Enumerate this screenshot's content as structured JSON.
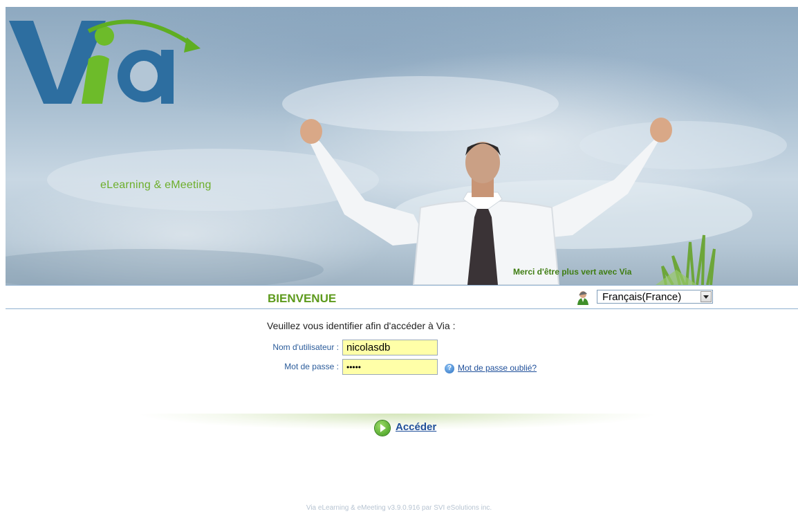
{
  "banner": {
    "logo_text": "Via",
    "logo_tagline": "eLearning & eMeeting",
    "slogan": "Merci d'être plus vert avec Via"
  },
  "header": {
    "title": "BIENVENUE",
    "language": {
      "icon": "user-language-icon",
      "selected": "Français(France)"
    }
  },
  "login": {
    "prompt": "Veuillez vous identifier afin d'accéder à Via :",
    "username_label": "Nom d'utilisateur :",
    "username_value": "nicolasdb",
    "password_label": "Mot de passe :",
    "password_value": "•••••",
    "forgot_link": "Mot de passe oublié?",
    "submit_label": "Accéder"
  },
  "footer": {
    "text": "Via eLearning & eMeeting v3.9.0.916 par SVI eSolutions inc."
  },
  "colors": {
    "accent_green": "#5d9a1c",
    "link_blue": "#1f4f9a",
    "input_bg": "#ffffa8"
  }
}
